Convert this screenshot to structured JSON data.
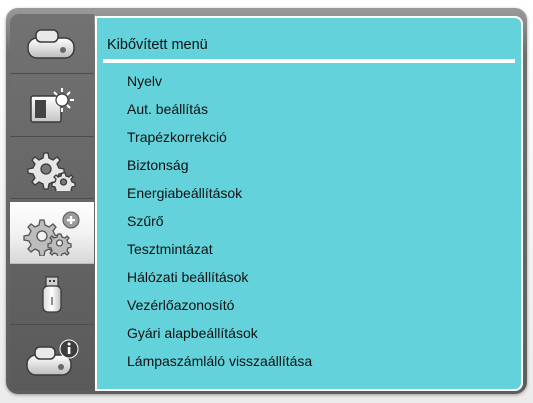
{
  "menu": {
    "title": "Kibővített menü",
    "items": [
      "Nyelv",
      "Aut. beállítás",
      "Trapézkorrekció",
      "Biztonság",
      "Energiabeállítások",
      "Szűrő",
      "Tesztmintázat",
      "Hálózati beállítások",
      "Vezérlőazonosító",
      "Gyári alapbeállítások",
      "Lámpaszámláló visszaállítása"
    ]
  },
  "sidebar": {
    "tabs": [
      {
        "icon": "projector-icon",
        "selected": false
      },
      {
        "icon": "picture-brightness-icon",
        "selected": false
      },
      {
        "icon": "gears-icon",
        "selected": false
      },
      {
        "icon": "gears-plus-icon",
        "selected": true
      },
      {
        "icon": "usb-icon",
        "selected": false
      },
      {
        "icon": "projector-info-icon",
        "selected": false
      }
    ]
  },
  "colors": {
    "panel_background": "#63d2db",
    "frame": "#6a6a6a",
    "selected_tab": "#ffffff",
    "text": "#111111"
  }
}
